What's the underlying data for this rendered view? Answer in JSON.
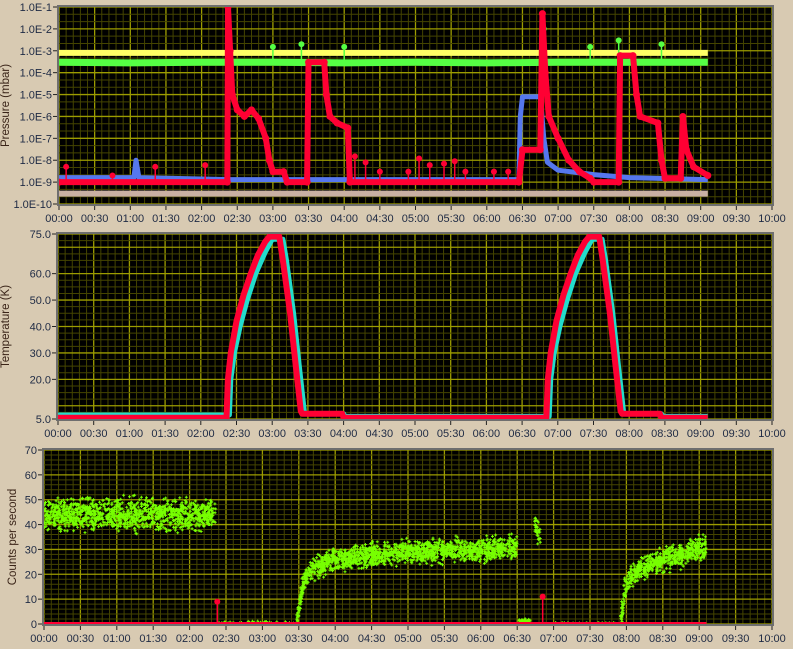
{
  "chart_data": [
    {
      "type": "line",
      "title": "",
      "ylabel": "Pressure (mbar)",
      "xlabel": "",
      "yscale": "log",
      "ylim": [
        1e-10,
        0.1
      ],
      "xlim_hours": [
        0,
        10
      ],
      "grid": true,
      "xticks": [
        "00:00",
        "00:30",
        "01:00",
        "01:30",
        "02:00",
        "02:30",
        "03:00",
        "03:30",
        "04:00",
        "04:30",
        "05:00",
        "05:30",
        "06:00",
        "06:30",
        "07:00",
        "07:30",
        "08:00",
        "08:30",
        "09:00",
        "09:30",
        "10:00"
      ],
      "yticks": [
        {
          "value": 1e-10,
          "label": "1.0E-10"
        },
        {
          "value": 1e-09,
          "label": "1.0E-9"
        },
        {
          "value": 1e-08,
          "label": "1.0E-8"
        },
        {
          "value": 1e-07,
          "label": "1.0E-7"
        },
        {
          "value": 1e-06,
          "label": "1.0E-6"
        },
        {
          "value": 1e-05,
          "label": "1.0E-5"
        },
        {
          "value": 0.0001,
          "label": "1.0E-4"
        },
        {
          "value": 0.001,
          "label": "1.0E-3"
        },
        {
          "value": 0.01,
          "label": "1.0E-2"
        },
        {
          "value": 0.1,
          "label": "1.0E-1"
        }
      ],
      "series": [
        {
          "name": "gauge-beige",
          "color": "#c9b0a4",
          "width": 6,
          "points": [
            [
              0,
              3e-10
            ],
            [
              9.1,
              3e-10
            ]
          ]
        },
        {
          "name": "gauge-yellow",
          "color": "#ffff66",
          "width": 6,
          "points": [
            [
              0,
              0.0008
            ],
            [
              9.1,
              0.0008
            ]
          ]
        },
        {
          "name": "gauge-green",
          "color": "#55ff44",
          "width": 7,
          "points": [
            [
              0,
              0.0003
            ],
            [
              1.0,
              0.00028
            ],
            [
              2.0,
              0.0003
            ],
            [
              3.0,
              0.0003
            ],
            [
              4.0,
              0.00028
            ],
            [
              5.0,
              0.0003
            ],
            [
              6.0,
              0.00028
            ],
            [
              7.0,
              0.0003
            ],
            [
              8.0,
              0.0003
            ],
            [
              9.1,
              0.0003
            ]
          ],
          "spikes": [
            [
              2.37,
              0.001
            ],
            [
              3.0,
              0.0015
            ],
            [
              3.4,
              0.002
            ],
            [
              4.0,
              0.0015
            ],
            [
              6.8,
              0.01
            ],
            [
              7.45,
              0.0015
            ],
            [
              7.85,
              0.003
            ],
            [
              8.45,
              0.002
            ]
          ]
        },
        {
          "name": "gauge-blue",
          "color": "#5577ee",
          "width": 5,
          "points": [
            [
              0,
              1.6e-09
            ],
            [
              1.05,
              1.6e-09
            ],
            [
              1.08,
              1e-08
            ],
            [
              1.12,
              1.6e-09
            ],
            [
              2.4,
              1.3e-09
            ],
            [
              6.45,
              1.3e-09
            ],
            [
              6.47,
              1e-06
            ],
            [
              6.5,
              8e-06
            ],
            [
              6.75,
              8e-06
            ],
            [
              6.8,
              1e-07
            ],
            [
              6.85,
              8e-09
            ],
            [
              7.0,
              3.5e-09
            ],
            [
              7.5,
              2.2e-09
            ],
            [
              8.0,
              1.6e-09
            ],
            [
              9.1,
              1.3e-09
            ]
          ]
        },
        {
          "name": "gauge-red",
          "color": "#ff0033",
          "width": 6,
          "points": [
            [
              0,
              1e-09
            ],
            [
              2.36,
              1e-09
            ],
            [
              2.37,
              0.1
            ],
            [
              2.4,
              0.001
            ],
            [
              2.43,
              1e-05
            ],
            [
              2.5,
              2e-06
            ],
            [
              2.6,
              1e-06
            ],
            [
              2.7,
              2e-06
            ],
            [
              2.8,
              8e-07
            ],
            [
              2.9,
              1e-07
            ],
            [
              2.95,
              1e-08
            ],
            [
              3.0,
              3e-09
            ],
            [
              3.15,
              3e-09
            ],
            [
              3.2,
              1e-09
            ],
            [
              3.48,
              1e-09
            ],
            [
              3.5,
              0.0003
            ],
            [
              3.72,
              0.0003
            ],
            [
              3.75,
              1e-05
            ],
            [
              3.8,
              1e-06
            ],
            [
              3.9,
              5e-07
            ],
            [
              4.05,
              3e-07
            ],
            [
              4.08,
              1e-09
            ],
            [
              6.45,
              1e-09
            ],
            [
              6.5,
              3e-08
            ],
            [
              6.75,
              3e-08
            ],
            [
              6.78,
              0.05
            ],
            [
              6.82,
              0.0001
            ],
            [
              6.87,
              1e-06
            ],
            [
              7.0,
              1e-07
            ],
            [
              7.15,
              1e-08
            ],
            [
              7.3,
              3e-09
            ],
            [
              7.45,
              1.5e-09
            ],
            [
              7.5,
              1e-09
            ],
            [
              7.85,
              1e-09
            ],
            [
              7.87,
              0.0006
            ],
            [
              8.05,
              0.0006
            ],
            [
              8.1,
              1e-05
            ],
            [
              8.15,
              1e-06
            ],
            [
              8.4,
              5e-07
            ],
            [
              8.45,
              1e-08
            ],
            [
              8.5,
              1.5e-09
            ],
            [
              8.72,
              1.5e-09
            ],
            [
              8.75,
              1e-06
            ],
            [
              8.8,
              3e-08
            ],
            [
              8.9,
              5e-09
            ],
            [
              9.1,
              2e-09
            ]
          ],
          "spikes": [
            [
              0.1,
              5e-09
            ],
            [
              0.75,
              2e-09
            ],
            [
              1.35,
              5e-09
            ],
            [
              2.05,
              6e-09
            ],
            [
              4.15,
              1.5e-08
            ],
            [
              4.3,
              8e-09
            ],
            [
              4.5,
              3e-09
            ],
            [
              4.9,
              3e-09
            ],
            [
              5.05,
              1.2e-08
            ],
            [
              5.2,
              6e-09
            ],
            [
              5.4,
              7e-09
            ],
            [
              5.55,
              9e-09
            ],
            [
              5.7,
              3e-09
            ],
            [
              6.1,
              3e-09
            ],
            [
              6.3,
              3e-09
            ]
          ]
        }
      ]
    },
    {
      "type": "line",
      "title": "",
      "ylabel": "Temperature (K)",
      "xlabel": "",
      "yscale": "linear",
      "ylim": [
        5,
        75
      ],
      "xlim_hours": [
        0,
        10
      ],
      "grid": true,
      "xticks": [
        "00:00",
        "00:30",
        "01:00",
        "01:30",
        "02:00",
        "02:30",
        "03:00",
        "03:30",
        "04:00",
        "04:30",
        "05:00",
        "05:30",
        "06:00",
        "06:30",
        "07:00",
        "07:30",
        "08:00",
        "08:30",
        "09:00",
        "09:30",
        "10:00"
      ],
      "yticks": [
        {
          "value": 5,
          "label": "5.0"
        },
        {
          "value": 20,
          "label": "20.0"
        },
        {
          "value": 30,
          "label": "30.0"
        },
        {
          "value": 40,
          "label": "40.0"
        },
        {
          "value": 50,
          "label": "50.0"
        },
        {
          "value": 60,
          "label": "60.0"
        },
        {
          "value": 75,
          "label": "75.0"
        }
      ],
      "series": [
        {
          "name": "sensor-cyan",
          "color": "#22ddcc",
          "width": 5,
          "points": [
            [
              0,
              6.5
            ],
            [
              2.4,
              6.5
            ],
            [
              2.42,
              20
            ],
            [
              2.47,
              30
            ],
            [
              2.55,
              40
            ],
            [
              2.65,
              50
            ],
            [
              2.77,
              60
            ],
            [
              2.9,
              68
            ],
            [
              3.0,
              73
            ],
            [
              3.15,
              73
            ],
            [
              3.2,
              65
            ],
            [
              3.3,
              45
            ],
            [
              3.38,
              25
            ],
            [
              3.45,
              8
            ],
            [
              3.47,
              7
            ],
            [
              4.0,
              7
            ],
            [
              4.02,
              6
            ],
            [
              6.88,
              6
            ],
            [
              6.9,
              20
            ],
            [
              6.95,
              30
            ],
            [
              7.03,
              40
            ],
            [
              7.13,
              50
            ],
            [
              7.25,
              60
            ],
            [
              7.38,
              68
            ],
            [
              7.48,
              73
            ],
            [
              7.62,
              73
            ],
            [
              7.67,
              65
            ],
            [
              7.77,
              45
            ],
            [
              7.85,
              25
            ],
            [
              7.92,
              8
            ],
            [
              7.94,
              7
            ],
            [
              8.45,
              7
            ],
            [
              8.47,
              6
            ],
            [
              9.1,
              6
            ]
          ]
        },
        {
          "name": "sensor-red",
          "color": "#ff0033",
          "width": 6,
          "points": [
            [
              0,
              5.5
            ],
            [
              2.36,
              5.5
            ],
            [
              2.38,
              20
            ],
            [
              2.42,
              30
            ],
            [
              2.5,
              42
            ],
            [
              2.6,
              52
            ],
            [
              2.7,
              60
            ],
            [
              2.8,
              67
            ],
            [
              2.9,
              72
            ],
            [
              2.96,
              74
            ],
            [
              3.1,
              74
            ],
            [
              3.15,
              65
            ],
            [
              3.25,
              45
            ],
            [
              3.33,
              25
            ],
            [
              3.4,
              8
            ],
            [
              3.42,
              7
            ],
            [
              3.98,
              7
            ],
            [
              4.0,
              5.5
            ],
            [
              6.84,
              5.5
            ],
            [
              6.86,
              20
            ],
            [
              6.9,
              30
            ],
            [
              6.98,
              42
            ],
            [
              7.08,
              52
            ],
            [
              7.18,
              60
            ],
            [
              7.28,
              67
            ],
            [
              7.38,
              72
            ],
            [
              7.44,
              74
            ],
            [
              7.58,
              74
            ],
            [
              7.63,
              65
            ],
            [
              7.73,
              45
            ],
            [
              7.81,
              25
            ],
            [
              7.88,
              8
            ],
            [
              7.9,
              7
            ],
            [
              8.43,
              7
            ],
            [
              8.45,
              5.5
            ],
            [
              9.1,
              5.5
            ]
          ]
        }
      ]
    },
    {
      "type": "scatter",
      "title": "",
      "ylabel": "Counts per second",
      "xlabel": "",
      "yscale": "linear",
      "ylim": [
        0,
        70
      ],
      "xlim_hours": [
        0,
        10
      ],
      "grid": true,
      "xticks": [
        "00:00",
        "00:30",
        "01:00",
        "01:30",
        "02:00",
        "02:30",
        "03:00",
        "03:30",
        "04:00",
        "04:30",
        "05:00",
        "05:30",
        "06:00",
        "06:30",
        "07:00",
        "07:30",
        "08:00",
        "08:30",
        "09:00",
        "09:30",
        "10:00"
      ],
      "yticks": [
        {
          "value": 0,
          "label": "0"
        },
        {
          "value": 10,
          "label": "10"
        },
        {
          "value": 20,
          "label": "20"
        },
        {
          "value": 30,
          "label": "30"
        },
        {
          "value": 40,
          "label": "40"
        },
        {
          "value": 50,
          "label": "50"
        },
        {
          "value": 60,
          "label": "60"
        },
        {
          "value": 70,
          "label": "70"
        }
      ],
      "series": [
        {
          "name": "counts-green",
          "color": "#77ff00",
          "style": "scatter-band",
          "bands": [
            {
              "trend": [
                [
                  0,
                  44
                ],
                [
                  2.36,
                  44
                ]
              ],
              "spread": 3.0,
              "density": 500
            },
            {
              "trend": [
                [
                  2.38,
                  0.5
                ],
                [
                  3.45,
                  0.5
                ]
              ],
              "spread": 0.3,
              "density": 40
            },
            {
              "trend": [
                [
                  3.47,
                  0
                ],
                [
                  3.52,
                  10
                ],
                [
                  3.58,
                  18
                ],
                [
                  3.7,
                  22
                ],
                [
                  3.9,
                  25
                ],
                [
                  4.3,
                  27
                ],
                [
                  5.0,
                  29
                ],
                [
                  6.0,
                  30
                ],
                [
                  6.5,
                  31
                ]
              ],
              "spread": 2.2,
              "density": 500
            },
            {
              "trend": [
                [
                  6.52,
                  1.2
                ],
                [
                  6.68,
                  1.2
                ]
              ],
              "spread": 0.4,
              "density": 300
            },
            {
              "trend": [
                [
                  6.74,
                  40
                ],
                [
                  6.82,
                  35
                ]
              ],
              "spread": 2.0,
              "density": 400
            },
            {
              "trend": [
                [
                  6.85,
                  0.3
                ],
                [
                  7.9,
                  0.3
                ]
              ],
              "spread": 0.2,
              "density": 40
            },
            {
              "trend": [
                [
                  7.92,
                  0
                ],
                [
                  7.97,
                  12
                ],
                [
                  8.02,
                  18
                ],
                [
                  8.2,
                  22
                ],
                [
                  8.5,
                  26
                ],
                [
                  9.1,
                  31
                ]
              ],
              "spread": 2.2,
              "density": 500
            }
          ]
        },
        {
          "name": "counts-red",
          "color": "#ff0033",
          "width": 4,
          "points": [
            [
              0,
              0
            ],
            [
              9.1,
              0
            ]
          ],
          "spikes": [
            [
              2.38,
              9
            ],
            [
              6.85,
              11
            ]
          ]
        }
      ]
    }
  ]
}
